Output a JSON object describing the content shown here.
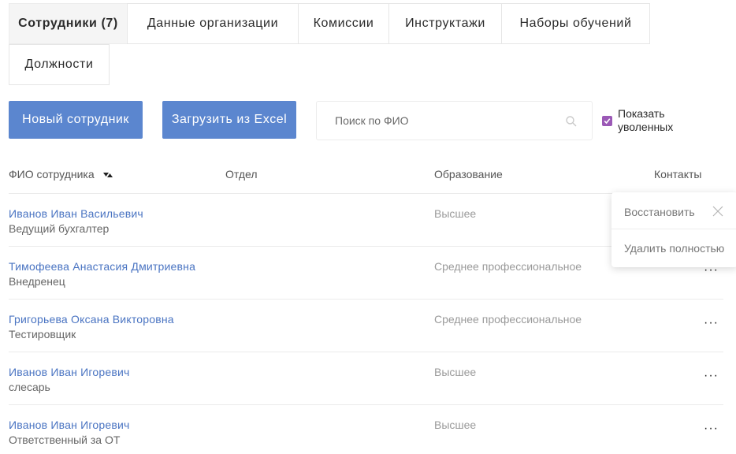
{
  "tabs": [
    {
      "label": "Сотрудники (7)",
      "active": true
    },
    {
      "label": "Данные организации",
      "active": false
    },
    {
      "label": "Комиссии",
      "active": false
    },
    {
      "label": "Инструктажи",
      "active": false
    },
    {
      "label": "Наборы обучений",
      "active": false
    },
    {
      "label": "Должности",
      "active": false
    }
  ],
  "toolbar": {
    "new_employee_label": "Новый сотрудник",
    "upload_excel_label": "Загрузить из Excel",
    "search_placeholder": "Поиск по ФИО",
    "search_value": "",
    "show_dismissed_label": "Показать уволенных",
    "show_dismissed_checked": true,
    "accent_color": "#5b86cf",
    "checkbox_color": "#9b59b6"
  },
  "table": {
    "columns": [
      "ФИО сотрудника",
      "Отдел",
      "Образование",
      "Контакты"
    ],
    "more_glyph": "···",
    "rows": [
      {
        "name": "Иванов Иван Васильевич",
        "position": "Ведущий бухгалтер",
        "department": "",
        "education": "Высшее"
      },
      {
        "name": "Тимофеева Анастасия Дмитриевна",
        "position": "Внедренец",
        "department": "",
        "education": "Среднее профессиональное"
      },
      {
        "name": "Григорьева Оксана Викторовна",
        "position": "Тестировщик",
        "department": "",
        "education": "Среднее профессиональное"
      },
      {
        "name": "Иванов Иван Игоревич",
        "position": "слесарь",
        "department": "",
        "education": "Высшее"
      },
      {
        "name": "Иванов Иван Игоревич",
        "position": "Ответственный за ОТ",
        "department": "",
        "education": "Высшее"
      }
    ]
  },
  "popup": {
    "restore_label": "Восстановить",
    "delete_label": "Удалить полностью"
  }
}
